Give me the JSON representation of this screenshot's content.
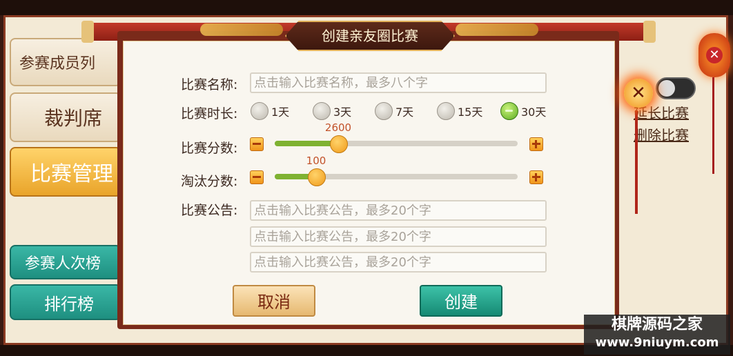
{
  "background": {
    "top_text": "",
    "side_buttons": [
      "参赛成员列",
      "裁判席",
      "比赛管理",
      "参赛人次榜",
      "排行榜"
    ],
    "right_links": [
      "延长比赛",
      "删除比赛"
    ]
  },
  "dialog": {
    "title": "创建亲友圈比赛",
    "name": {
      "label": "比赛名称:",
      "placeholder": "点击输入比赛名称，最多八个字"
    },
    "duration": {
      "label": "比赛时长:",
      "options": [
        "1天",
        "3天",
        "7天",
        "15天",
        "30天"
      ],
      "selected": "30天"
    },
    "score": {
      "label": "比赛分数:",
      "value": "2600",
      "fraction": 0.26
    },
    "elimination": {
      "label": "淘汰分数:",
      "value": "100",
      "fraction": 0.17
    },
    "notice": {
      "label": "比赛公告:",
      "placeholders": [
        "点击输入比赛公告，最多20个字",
        "点击输入比赛公告，最多20个字",
        "点击输入比赛公告，最多20个字"
      ]
    },
    "cancel_label": "取消",
    "create_label": "创建"
  },
  "watermark": {
    "line1": "棋牌源码之家",
    "line2": "www.9niuym.com"
  },
  "colors": {
    "accent_green": "#7fb232",
    "slider_thumb": "#f09a1a",
    "create_button": "#1e9b84",
    "frame_red": "#8d1f14"
  }
}
